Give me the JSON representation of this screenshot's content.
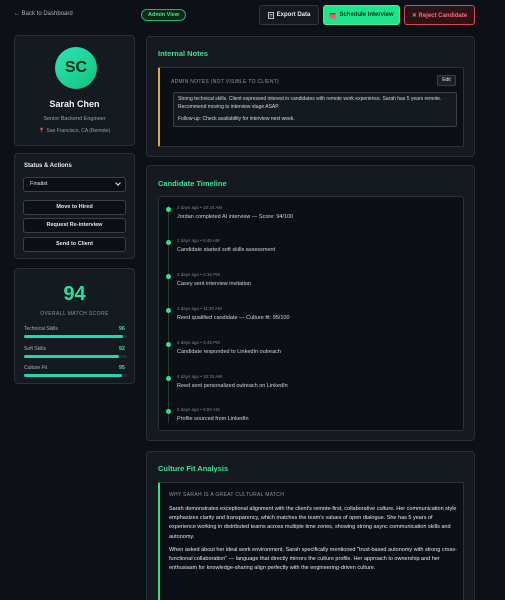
{
  "topbar": {
    "back_label": "← Back to Dashboard",
    "admin_badge": "Admin View",
    "export_label": "Export Data",
    "schedule_label": "Schedule Interview",
    "reject_label": "✕ Reject Candidate"
  },
  "profile": {
    "initials": "SC",
    "name": "Sarah Chen",
    "title": "Senior Backend Engineer",
    "location": "San Francisco, CA (Remote)"
  },
  "status": {
    "title": "Status & Actions",
    "selected": "Finalist",
    "buttons": [
      "Move to Hired",
      "Request Re-interview",
      "Send to Client"
    ]
  },
  "score": {
    "value": "94",
    "label": "OVERALL MATCH SCORE",
    "metrics": [
      {
        "name": "Technical Skills",
        "value": "96",
        "percent": 96
      },
      {
        "name": "Soft Skills",
        "value": "92",
        "percent": 92
      },
      {
        "name": "Culture Fit",
        "value": "95",
        "percent": 95
      }
    ]
  },
  "notes": {
    "title": "Internal Notes",
    "header": "ADMIN NOTES (NOT VISIBLE TO CLIENT)",
    "edit_label": "Edit",
    "line1": "Strong technical skills. Client expressed interest in candidates with remote work experience. Sarah has 5 years remote. Recommend moving to interview stage ASAP.",
    "line2": "Follow-up: Check availability for interview next week."
  },
  "timeline": {
    "title": "Candidate Timeline",
    "events": [
      {
        "time": "2 days ago • 10:24 AM",
        "text": "Jordan completed AI interview — Score: 94/100"
      },
      {
        "time": "2 days ago • 8:45 AM",
        "text": "Candidate started soft skills assessment"
      },
      {
        "time": "3 days ago • 2:15 PM",
        "text": "Casey sent interview invitation"
      },
      {
        "time": "3 days ago • 11:30 AM",
        "text": "Reed qualified candidate — Culture fit: 95/100"
      },
      {
        "time": "4 days ago • 3:45 PM",
        "text": "Candidate responded to LinkedIn outreach"
      },
      {
        "time": "4 days ago • 10:15 AM",
        "text": "Reed sent personalized outreach on LinkedIn"
      },
      {
        "time": "5 days ago • 9:00 AM",
        "text": "Profile sourced from LinkedIn"
      }
    ]
  },
  "culture": {
    "title": "Culture Fit Analysis",
    "header": "WHY SARAH IS A GREAT CULTURAL MATCH",
    "para1": "Sarah demonstrates exceptional alignment with the client's remote-first, collaborative culture. Her communication style emphasizes clarity and transparency, which matches the team's values of open dialogue. She has 5 years of experience working in distributed teams across multiple time zones, showing strong async communication skills and autonomy.",
    "para2": "When asked about her ideal work environment, Sarah specifically mentioned \"trust-based autonomy with strong cross-functional collaboration\" — language that directly mirrors the culture profile. Her approach to ownership and her enthusiasm for knowledge-sharing align perfectly with the engineering-driven culture."
  },
  "colors": {
    "accent": "#36e58f",
    "reject": "#ff6b75",
    "notes_accent": "#e3a93a",
    "background": "#0d1016"
  }
}
